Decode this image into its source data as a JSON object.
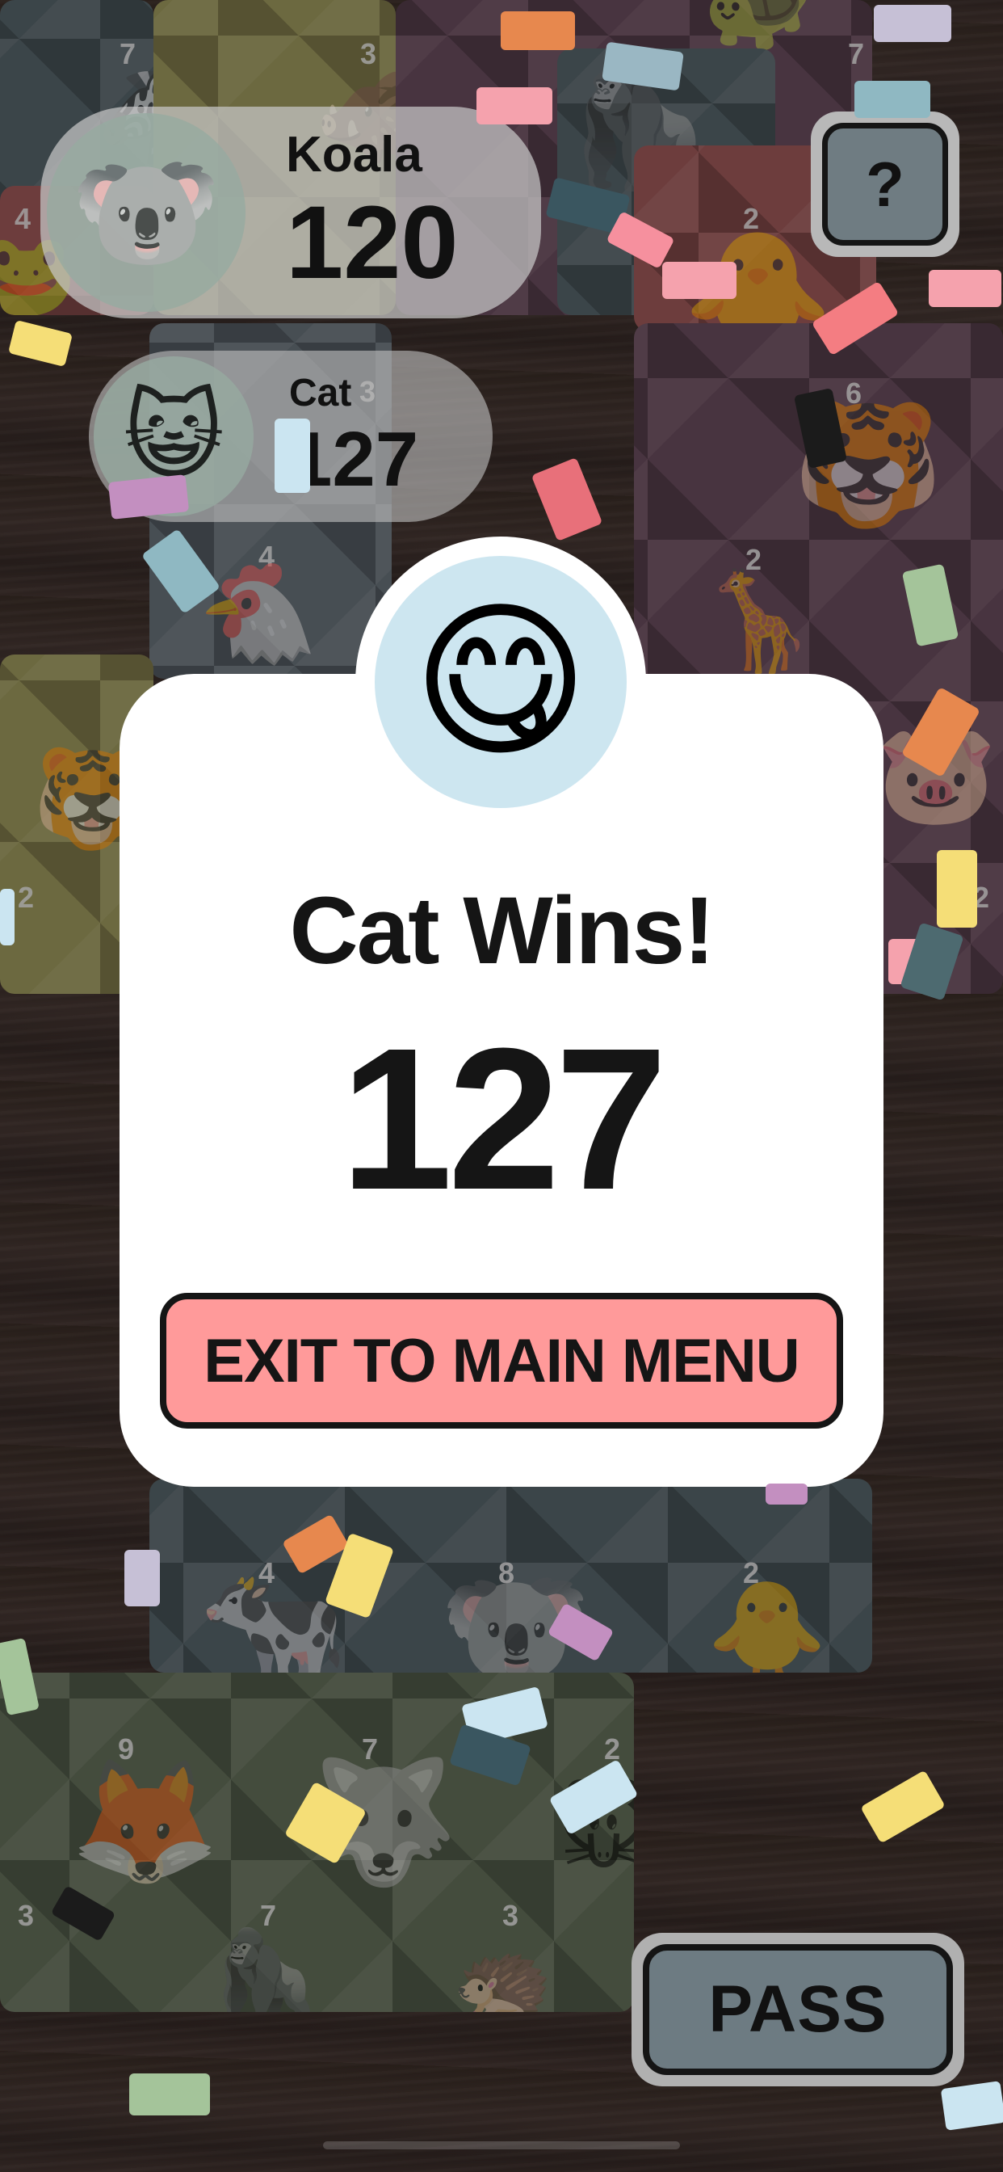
{
  "players": [
    {
      "name": "Koala",
      "score": "120",
      "avatar_icon": "koala-icon",
      "avatar_glyph": "🐨"
    },
    {
      "name": "Cat",
      "score": "127",
      "avatar_icon": "cat-icon",
      "avatar_glyph": "😺"
    }
  ],
  "help_button": {
    "label": "?"
  },
  "pass_button": {
    "label": "PASS"
  },
  "result_modal": {
    "winner_icon": "cat-face-tongue-icon",
    "winner_glyph": "😋",
    "title": "Cat Wins!",
    "score": "127",
    "exit_label": "EXIT TO MAIN MENU"
  },
  "tiles": [
    {
      "num": "7",
      "glyph": "🦓"
    },
    {
      "num": "3",
      "glyph": "🐗"
    },
    {
      "num": "7",
      "glyph": "🐢"
    },
    {
      "num": "4",
      "glyph": "🐸"
    },
    {
      "num": "2",
      "glyph": "🦍"
    },
    {
      "num": "2",
      "glyph": "🐥"
    },
    {
      "num": "3",
      "glyph": "🐐"
    },
    {
      "num": "6",
      "glyph": "🐯"
    },
    {
      "num": "4",
      "glyph": "🐔"
    },
    {
      "num": "2",
      "glyph": "🦒"
    },
    {
      "num": "2",
      "glyph": "🐷"
    },
    {
      "num": "4",
      "glyph": "🐄"
    },
    {
      "num": "8",
      "glyph": "🐨"
    },
    {
      "num": "2",
      "glyph": "🐥"
    },
    {
      "num": "9",
      "glyph": "🦊"
    },
    {
      "num": "7",
      "glyph": "🐺"
    },
    {
      "num": "2",
      "glyph": "🐭"
    },
    {
      "num": "3",
      "glyph": "🐗"
    },
    {
      "num": "7",
      "glyph": "🦍"
    },
    {
      "num": "3",
      "glyph": "🦔"
    }
  ],
  "colors": {
    "modal_bg": "#ffffff",
    "exit_button": "#ff9a9a",
    "badge_ring": "#cde6f0",
    "text_dark": "#151515"
  }
}
